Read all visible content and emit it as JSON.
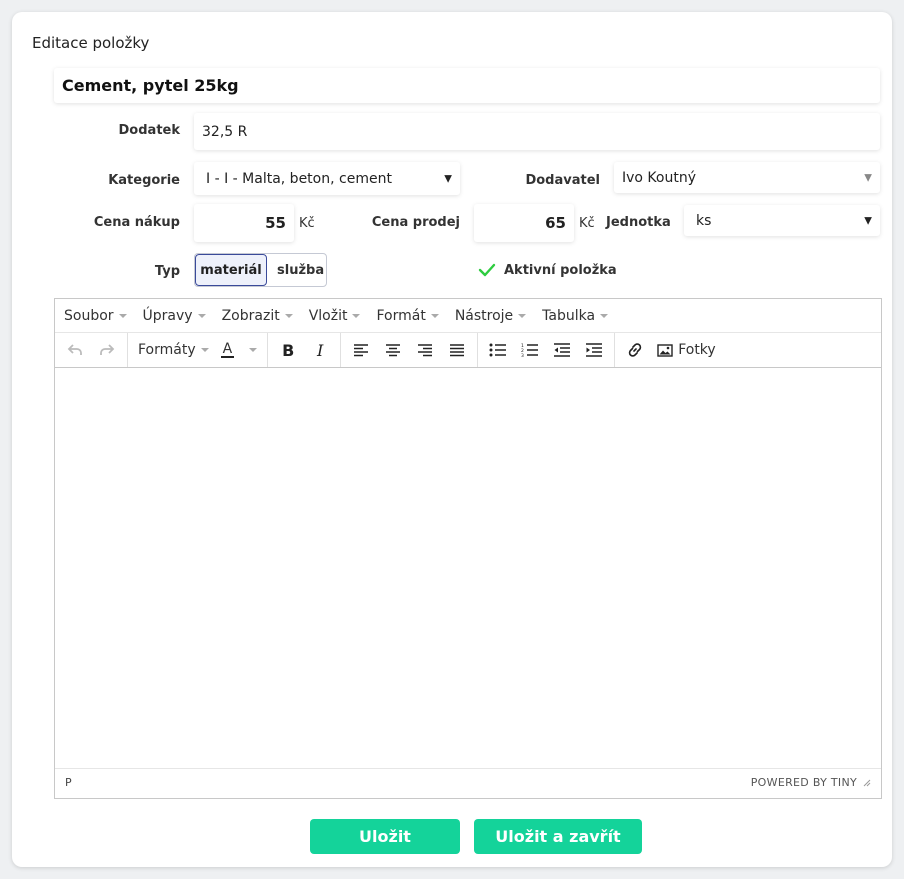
{
  "dialog": {
    "title": "Editace položky"
  },
  "item_name": "Cement, pytel 25kg",
  "fields": {
    "dodatek": {
      "label": "Dodatek",
      "value": "32,5 R"
    },
    "kategorie": {
      "label": "Kategorie",
      "value": "I - I - Malta, beton, cement"
    },
    "dodavatel": {
      "label": "Dodavatel",
      "value": "Ivo Koutný"
    },
    "cena_nakup": {
      "label": "Cena nákup",
      "value": "55",
      "unit": "Kč"
    },
    "cena_prodej": {
      "label": "Cena prodej",
      "value": "65",
      "unit": "Kč"
    },
    "jednotka": {
      "label": "Jednotka",
      "value": "ks"
    },
    "typ": {
      "label": "Typ",
      "options": [
        "materiál",
        "služba"
      ],
      "selected": "materiál"
    },
    "aktivni": {
      "label": "Aktivní položka",
      "checked": true
    }
  },
  "editor": {
    "menus": [
      "Soubor",
      "Úpravy",
      "Zobrazit",
      "Vložit",
      "Formát",
      "Nástroje",
      "Tabulka"
    ],
    "formats_label": "Formáty",
    "photos_label": "Fotky",
    "status_path": "P",
    "powered_by": "POWERED BY TINY"
  },
  "buttons": {
    "save": "Uložit",
    "save_close": "Uložit a zavřít"
  },
  "colors": {
    "accent": "#14d39a",
    "check": "#2ecc40",
    "toggle_border": "#3a4a9a"
  }
}
